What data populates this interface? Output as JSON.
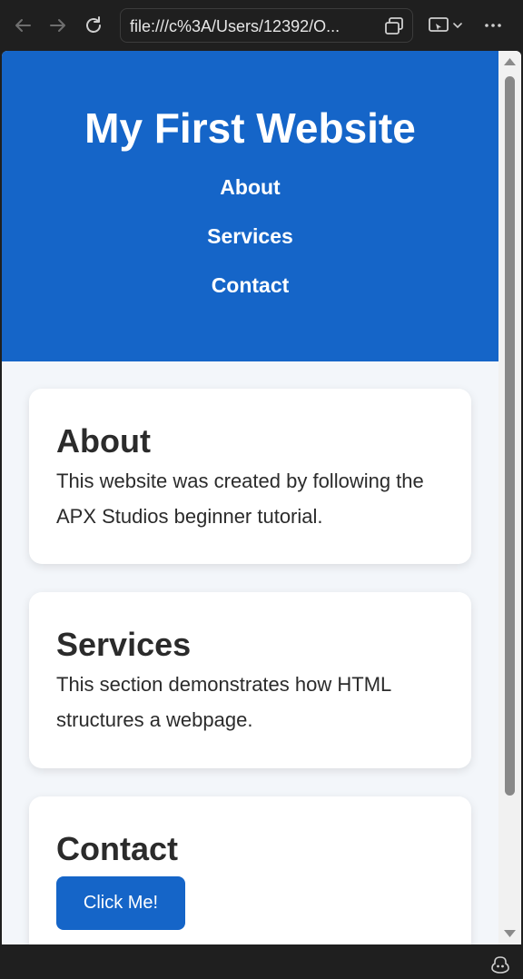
{
  "browser": {
    "back_icon": "arrow-left-icon",
    "forward_icon": "arrow-right-icon",
    "reload_icon": "reload-icon",
    "address": "file:///c%3A/Users/12392/O...",
    "address_action_icon": "tab-switch-icon",
    "cast_icon": "cast-icon",
    "menu_icon": "more-icon",
    "copilot_icon": "copilot-icon"
  },
  "site": {
    "title": "My First Website",
    "nav": [
      "About",
      "Services",
      "Contact"
    ]
  },
  "sections": [
    {
      "heading": "About",
      "text": "This website was created by following the APX Studios beginner tutorial."
    },
    {
      "heading": "Services",
      "text": "This section demonstrates how HTML structures a webpage."
    },
    {
      "heading": "Contact",
      "button": "Click Me!"
    }
  ],
  "colors": {
    "header_bg": "#1565c8",
    "page_bg": "#f3f6fa",
    "button_bg": "#1565c8"
  }
}
